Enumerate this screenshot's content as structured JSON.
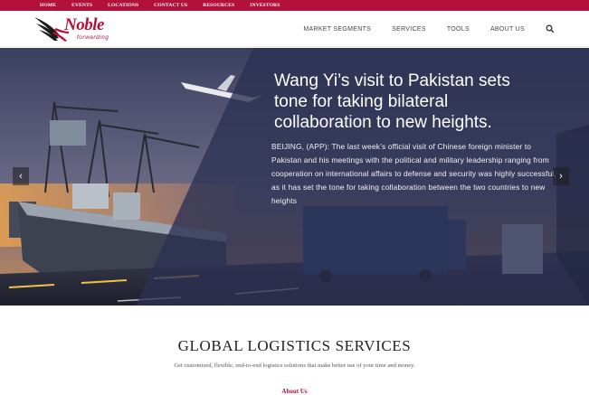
{
  "topbar": {
    "items": [
      "HOME",
      "EVENTS",
      "LOCATIONS",
      "CONTACT US",
      "RESOURCES",
      "INVESTORS"
    ]
  },
  "logo": {
    "name": "Noble",
    "tagline": "forwarding"
  },
  "nav": {
    "items": [
      "MARKET SEGMENTS",
      "SERVICES",
      "TOOLS",
      "ABOUT US"
    ],
    "search_icon": "search-icon"
  },
  "hero": {
    "title": "Wang Yi’s visit to Pakistan sets tone for taking bilateral collaboration to new heights.",
    "body": "BEIJING, (APP): The last week’s official visit of Chinese foreign minister to Pakistan and his meetings with the political and military leadership ranging from cooperation on international affairs to defense and security was highly successful, as it has set the tone for taking collaboration between the two countries to new heights",
    "prev_icon": "chevron-left-icon",
    "next_icon": "chevron-right-icon"
  },
  "services": {
    "title": "GLOBAL LOGISTICS SERVICES",
    "subtitle": "Get customized, flexible, end-to-end logistics solutions that make better use of your time and money.",
    "link": "About Us"
  },
  "colors": {
    "brand": "#b3113a",
    "hero_overlay": "#2c3152"
  }
}
